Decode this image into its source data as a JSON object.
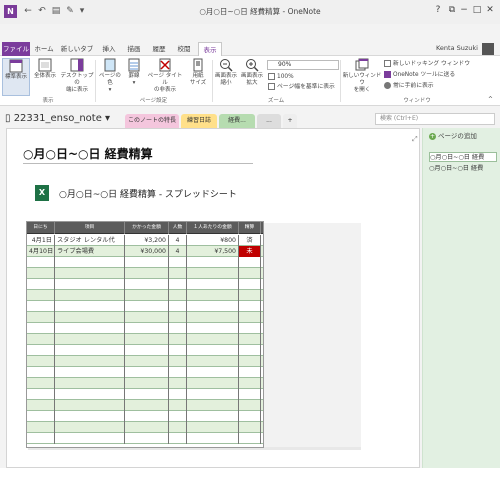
{
  "window": {
    "title": "○月○日~○日 経費精算 - OneNote",
    "app_icon": "N",
    "controls": [
      "?",
      "⧉",
      "−",
      "□",
      "✕"
    ]
  },
  "quick_access": [
    "←",
    "↶",
    "▤",
    "✎",
    "▾"
  ],
  "menu": {
    "tabs": [
      "ファイル",
      "ホーム",
      "新しいタブ",
      "挿入",
      "描画",
      "履歴",
      "校閲",
      "表示"
    ],
    "active": "表示",
    "user": "Kenta Suzuki"
  },
  "ribbon": {
    "view_group": {
      "label": "表示",
      "normal": "標準表示",
      "full": "全体表示",
      "dock": [
        "デスクトップの",
        "端に表示"
      ]
    },
    "page_setup_group": {
      "label": "ページ設定",
      "page_color": [
        "ページの色",
        "▾"
      ],
      "rule_lines": [
        "罫線",
        "▾"
      ],
      "hide_title": [
        "ページ タイトル",
        "の非表示"
      ],
      "paper_size": [
        "用紙",
        "サイズ"
      ]
    },
    "zoom_group": {
      "label": "ズーム",
      "zoom_out": [
        "画面表示",
        "縮小"
      ],
      "zoom_in": [
        "画面表示",
        "拡大"
      ],
      "zoom_value": "90%",
      "zoom_100": "100%",
      "page_width": "ページ幅を基準に表示"
    },
    "window_group": {
      "label": "ウィンドウ",
      "new_window": [
        "新しいウィンドウ",
        "を開く"
      ],
      "new_docked": "新しいドッキング ウィンドウ",
      "send_tool": "OneNote ツールに送る",
      "always_top": "常に手前に表示"
    }
  },
  "notebook": {
    "name": "22331_enso_note",
    "sections": [
      "このノートの特長",
      "練習日誌",
      "経費...",
      "...",
      "+"
    ],
    "search_placeholder": "検索 (Ctrl+E)"
  },
  "page": {
    "title": "○月○日~○日 経費精算",
    "attachment_name": "○月○日~○日 経費精算 - スプレッドシート",
    "attachment_icon": "X",
    "expand_glyph": "⤢"
  },
  "spreadsheet": {
    "headers": [
      "日にち",
      "項目",
      "かかった金額",
      "人数",
      "１人あたりの金額",
      "精算"
    ],
    "rows": [
      [
        "4月1日",
        "スタジオ レンタル代",
        "¥3,200",
        "4",
        "¥800",
        "済"
      ],
      [
        "4月10日",
        "ライブ会場費",
        "¥30,000",
        "4",
        "¥7,500",
        "未"
      ]
    ],
    "status_colors": {
      "done": "#ffffff",
      "pending": "#c00000"
    }
  },
  "pages_pane": {
    "add_label": "ページの追加",
    "pages": [
      "○月○日~○日 経費",
      "○月○日~○日 経費"
    ]
  },
  "colors": {
    "accent": "#7b3c9c",
    "excel_green": "#1e7145",
    "pane_green": "#e2f0e2",
    "section_1": "#f4c6dd",
    "section_2": "#ffe08a",
    "section_3": "#b6dcb0"
  }
}
